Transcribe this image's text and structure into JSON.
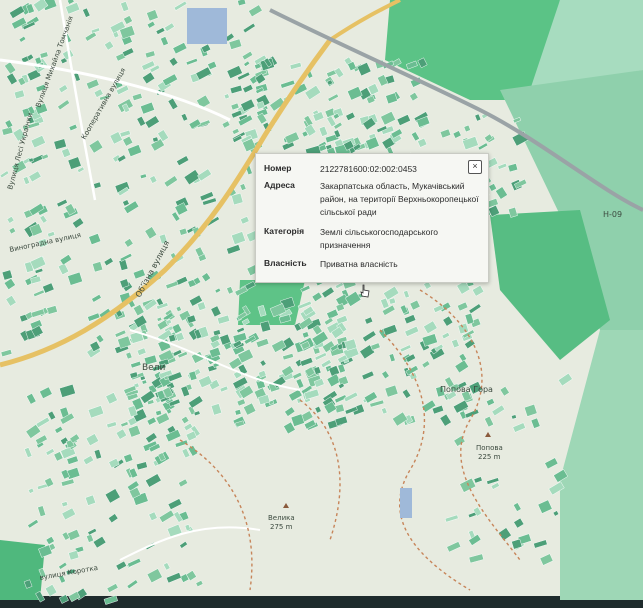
{
  "popup": {
    "fields": [
      {
        "key": "Номер",
        "value": "2122781600:02:002:0453"
      },
      {
        "key": "Адреса",
        "value": "Закарпатська область, Мукачівський район, на території Верхньокоропецької сільської ради"
      },
      {
        "key": "Категорія",
        "value": "Землі сільськогосподарського призначення"
      },
      {
        "key": "Власність",
        "value": "Приватна власність"
      }
    ],
    "close_label": "×"
  },
  "labels": {
    "road_h09": "Н-09",
    "street_obyizna": "Обʼїзна вулиця",
    "street_lesi": "Вулиця Лесі Українки",
    "street_mykhaila": "Вулиця Михайла Томчанія",
    "street_kooperatyvna": "Кооперативна вулиця",
    "street_vynohradna": "Виноградна вулиця",
    "street_korotka": "вулиця Короткa",
    "popova_gora": "Попова Гора",
    "popova_peak": "Попова",
    "popova_elev": "225 m",
    "velyka_peak": "Велика",
    "velyka_elev": "275 m",
    "village_part": "Вели"
  },
  "colors": {
    "map_bg": "#eceee4",
    "parcel": "#7fc79e",
    "parcel_dark": "#4d9f78",
    "field": "#58c083",
    "forest": "#9bd5b3",
    "road": "#e9c56b"
  }
}
